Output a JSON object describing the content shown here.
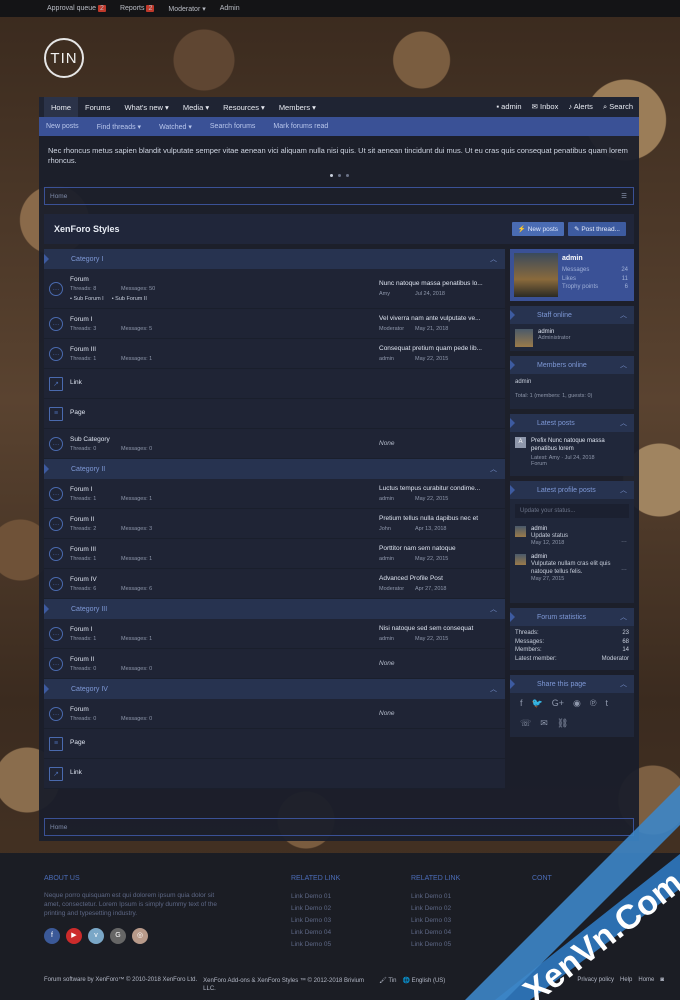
{
  "topbar": {
    "items": [
      {
        "label": "Approval queue",
        "badge": "2"
      },
      {
        "label": "Reports",
        "badge": "2"
      },
      {
        "label": "Moderator ▾",
        "badge": ""
      },
      {
        "label": "Admin",
        "badge": ""
      }
    ]
  },
  "logo": {
    "text": "TIN"
  },
  "nav": {
    "items": [
      "Home",
      "Forums",
      "What's new ▾",
      "Media ▾",
      "Resources ▾",
      "Members ▾"
    ],
    "user": "admin",
    "inbox": "Inbox",
    "alerts": "Alerts",
    "search": "Search"
  },
  "subnav": {
    "items": [
      "New posts",
      "Find threads ▾",
      "Watched ▾",
      "Search forums",
      "Mark forums read"
    ]
  },
  "notice": {
    "text": "Nec rhoncus metus sapien blandit vulputate semper vitae aenean vici aliquam nulla nisi quis. Ut sit aenean tincidunt dui mus. Ut eu cras quis consequat penatibus quam lorem rhoncus."
  },
  "breadcrumb": {
    "home": "Home"
  },
  "page": {
    "title": "XenForo Styles",
    "new_posts": "New posts",
    "post_thread": "Post thread..."
  },
  "categories": [
    {
      "name": "Category I",
      "nodes": [
        {
          "type": "forum",
          "title": "Forum",
          "threads": "Threads: 8",
          "messages": "Messages: 50",
          "subs": [
            "Sub Forum I",
            "Sub Forum II"
          ],
          "last_title": "Nunc natoque massa penatibus lo...",
          "last_user": "Amy",
          "last_date": "Jul 24, 2018"
        },
        {
          "type": "forum",
          "title": "Forum I",
          "threads": "Threads: 3",
          "messages": "Messages: 5",
          "subs": [],
          "last_title": "Vel viverra nam ante vulputate ve...",
          "last_user": "Moderator",
          "last_date": "May 21, 2018"
        },
        {
          "type": "forum",
          "title": "Forum III",
          "threads": "Threads: 1",
          "messages": "Messages: 1",
          "subs": [],
          "last_title": "Consequat pretium quam pede lib...",
          "last_user": "admin",
          "last_date": "May 22, 2015"
        },
        {
          "type": "link",
          "title": "Link"
        },
        {
          "type": "page",
          "title": "Page"
        },
        {
          "type": "forum",
          "title": "Sub Category",
          "threads": "Threads: 0",
          "messages": "Messages: 0",
          "subs": [],
          "none": "None"
        }
      ]
    },
    {
      "name": "Category II",
      "nodes": [
        {
          "type": "forum",
          "title": "Forum I",
          "threads": "Threads: 1",
          "messages": "Messages: 1",
          "subs": [],
          "last_title": "Luctus tempus curabitur condime...",
          "last_user": "admin",
          "last_date": "May 22, 2015"
        },
        {
          "type": "forum",
          "title": "Forum II",
          "threads": "Threads: 2",
          "messages": "Messages: 3",
          "subs": [],
          "last_title": "Pretium tellus nulla dapibus nec et",
          "last_user": "John",
          "last_date": "Apr 13, 2018"
        },
        {
          "type": "forum",
          "title": "Forum III",
          "threads": "Threads: 1",
          "messages": "Messages: 1",
          "subs": [],
          "last_title": "Porttitor nam sem natoque",
          "last_user": "admin",
          "last_date": "May 22, 2015"
        },
        {
          "type": "forum",
          "title": "Forum IV",
          "threads": "Threads: 6",
          "messages": "Messages: 6",
          "subs": [],
          "last_title": "Advanced Profile Post",
          "last_user": "Moderator",
          "last_date": "Apr 27, 2018"
        }
      ]
    },
    {
      "name": "Category III",
      "nodes": [
        {
          "type": "forum",
          "title": "Forum I",
          "threads": "Threads: 1",
          "messages": "Messages: 1",
          "subs": [],
          "last_title": "Nisi natoque sed sem consequat",
          "last_user": "admin",
          "last_date": "May 22, 2015"
        },
        {
          "type": "forum",
          "title": "Forum II",
          "threads": "Threads: 0",
          "messages": "Messages: 0",
          "subs": [],
          "none": "None"
        }
      ]
    },
    {
      "name": "Category IV",
      "nodes": [
        {
          "type": "forum",
          "title": "Forum",
          "threads": "Threads: 0",
          "messages": "Messages: 0",
          "subs": [],
          "none": "None"
        },
        {
          "type": "page",
          "title": "Page"
        },
        {
          "type": "link",
          "title": "Link"
        }
      ]
    }
  ],
  "sidebar": {
    "profile": {
      "name": "admin",
      "rows": [
        [
          "Messages",
          "24"
        ],
        [
          "Likes",
          "11"
        ],
        [
          "Trophy points",
          "6"
        ]
      ]
    },
    "staff": {
      "title": "Staff online",
      "name": "admin",
      "role": "Administrator"
    },
    "members": {
      "title": "Members online",
      "names": "admin",
      "total": "Total: 1 (members: 1, guests: 0)"
    },
    "latest": {
      "title": "Latest posts",
      "avatar": "A",
      "post": "Prefix Nunc natoque massa penatibus lorem",
      "meta": "Latest: Amy · Jul 24, 2018",
      "forum": "Forum"
    },
    "profile_posts": {
      "title": "Latest profile posts",
      "placeholder": "Update your status...",
      "items": [
        {
          "name": "admin",
          "text": "Update status",
          "date": "May 12, 2018"
        },
        {
          "name": "admin",
          "text": "Vulputate nullam cras elit quis natoque tellus felis.",
          "date": "May 27, 2015"
        }
      ]
    },
    "stats": {
      "title": "Forum statistics",
      "rows": [
        [
          "Threads:",
          "23"
        ],
        [
          "Messages:",
          "68"
        ],
        [
          "Members:",
          "14"
        ],
        [
          "Latest member:",
          "Moderator"
        ]
      ]
    },
    "share": {
      "title": "Share this page"
    }
  },
  "bottom_crumb": {
    "home": "Home"
  },
  "footer": {
    "about_title": "ABOUT US",
    "about_text": "Neque porro quisquam est qui dolorem ipsum quia dolor sit amet, consectetur. Lorem Ipsum is simply dummy text of the printing and typesetting industry.",
    "col2_title": "RELATED LINK",
    "col2_links": [
      "Link Demo 01",
      "Link Demo 02",
      "Link Demo 03",
      "Link Demo 04",
      "Link Demo 05"
    ],
    "col3_title": "RELATED LINK",
    "col3_links": [
      "Link Demo 01",
      "Link Demo 02",
      "Link Demo 03",
      "Link Demo 04",
      "Link Demo 05"
    ],
    "col4_title": "CONT",
    "copyright": "Forum software by XenForo™ © 2010-2018 XenForo Ltd.",
    "addons": "XenForo Add-ons & XenForo Styles ™ © 2012-2018 Brivium LLC.",
    "style": "Tin",
    "lang": "English (US)",
    "links": [
      "Privacy policy",
      "Help",
      "Home"
    ]
  },
  "watermark": {
    "text": "XenVn.Com"
  },
  "colors": {
    "accent": "#3a5196",
    "panel": "#20273a",
    "link": "#7e98d6"
  }
}
